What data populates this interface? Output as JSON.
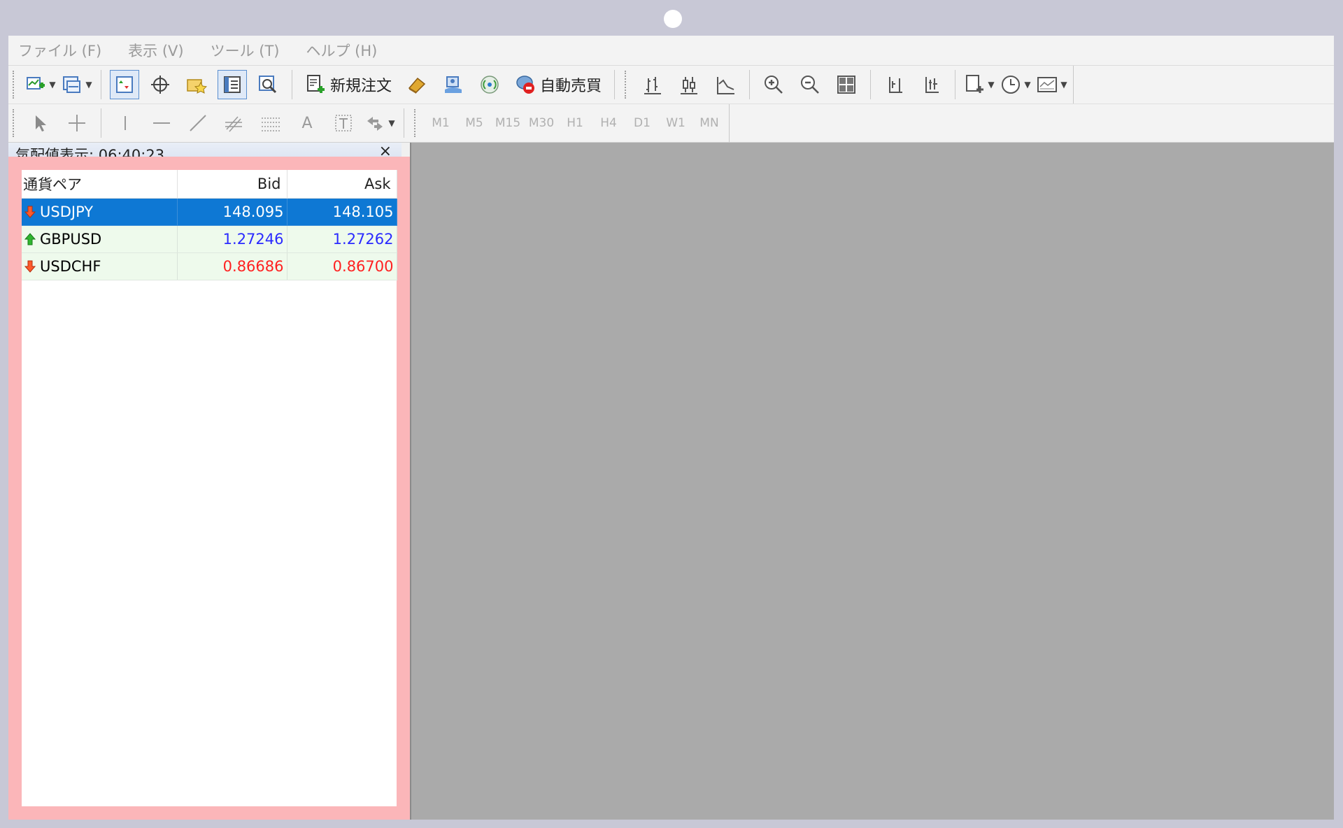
{
  "menu": [
    {
      "label": "ファイル (F)"
    },
    {
      "label": "表示 (V)"
    },
    {
      "label": "ツール (T)"
    },
    {
      "label": "ヘルプ (H)"
    }
  ],
  "toolbar": {
    "new_order_label": "新規注文",
    "auto_trade_label": "自動売買",
    "icons": [
      "new-chart-icon",
      "profiles-icon",
      "market-watch-icon",
      "crosshair-icon",
      "favorites-icon",
      "navigator-icon",
      "strategy-tester-icon",
      "new-order-icon",
      "metaeditor-icon",
      "signals-icon",
      "auto-trading-icon",
      "bar-chart-icon",
      "candlestick-icon",
      "line-chart-icon",
      "zoom-in-icon",
      "zoom-out-icon",
      "tile-windows-icon",
      "chart-shift-icon",
      "autoscroll-icon",
      "indicators-icon",
      "periodicity-icon",
      "templates-icon"
    ]
  },
  "drawing_toolbar": {
    "icons": [
      "cursor-icon",
      "crosshair-tool-icon",
      "vertical-line-icon",
      "horizontal-line-icon",
      "trendline-icon",
      "fibonacci-icon",
      "grid-icon",
      "text-icon",
      "text-label-icon",
      "arrows-icon"
    ],
    "text_tool": "A",
    "timeframes": [
      "M1",
      "M5",
      "M15",
      "M30",
      "H1",
      "H4",
      "D1",
      "W1",
      "MN"
    ]
  },
  "market_watch": {
    "title": "気配値表示: 06:40:23",
    "close": "×",
    "columns": {
      "symbol": "通貨ペア",
      "bid": "Bid",
      "ask": "Ask"
    },
    "rows": [
      {
        "symbol": "USDJPY",
        "bid": "148.095",
        "ask": "148.105",
        "direction": "down",
        "selected": true,
        "color": "#ffffff"
      },
      {
        "symbol": "GBPUSD",
        "bid": "1.27246",
        "ask": "1.27262",
        "direction": "up",
        "selected": false,
        "color": "#2a2aff"
      },
      {
        "symbol": "USDCHF",
        "bid": "0.86686",
        "ask": "0.86700",
        "direction": "down",
        "selected": false,
        "color": "#ff2020"
      }
    ]
  },
  "colors": {
    "highlight": "#fbb6b9",
    "selected_row": "#0e78d4",
    "chart_bg": "#aaaaaa"
  }
}
